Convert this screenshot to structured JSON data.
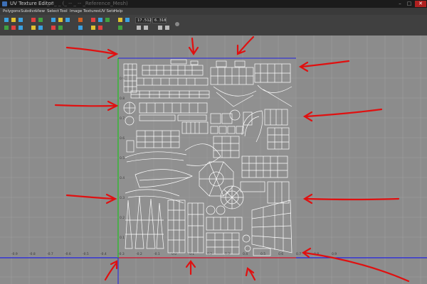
{
  "window": {
    "title": "UV Texture Editor",
    "subtitle": "_ 3_ _ (_ -- _ -- _Reference_Mesh)",
    "controls": {
      "minimize": "–",
      "maximize": "□",
      "close": "✕"
    }
  },
  "menu": [
    "Polygons",
    "Subdivs",
    "View",
    "Select",
    "Tool",
    "Image",
    "Textures",
    "UV Sets",
    "Help"
  ],
  "toolbar": {
    "field1_value": "17.512",
    "field2_value": "6.318"
  },
  "axes": {
    "left_labels": [
      "0.9",
      "0.8",
      "0.7",
      "0.6",
      "0.5",
      "0.4",
      "0.3",
      "0.2",
      "0.1"
    ],
    "bottom_labels": [
      "-0.9",
      "-0.8",
      "-0.7",
      "-0.6",
      "-0.5",
      "-0.4",
      "-0.3",
      "-0.2",
      "-0.1",
      "0.0",
      "0.1",
      "0.2",
      "0.3",
      "0.4",
      "0.5",
      "0.6",
      "0.7",
      "0.8",
      "0.9"
    ]
  },
  "colors": {
    "grid_bg": "#8c8c8c",
    "uv_lines": "#ffffff",
    "annotation": "#e01010",
    "u_axis": "#2020e0",
    "v_axis": "#20c020",
    "origin_axis": "#e02020"
  },
  "annotations": {
    "arrow_count": 14,
    "description_icon": "red-arrow-icon"
  }
}
